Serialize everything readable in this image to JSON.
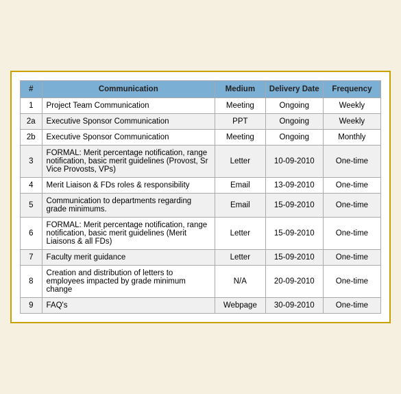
{
  "table": {
    "headers": {
      "num": "#",
      "communication": "Communication",
      "medium": "Medium",
      "delivery_date": "Delivery Date",
      "frequency": "Frequency"
    },
    "rows": [
      {
        "num": "1",
        "communication": "Project Team Communication",
        "medium": "Meeting",
        "delivery_date": "Ongoing",
        "frequency": "Weekly"
      },
      {
        "num": "2a",
        "communication": "Executive Sponsor Communication",
        "medium": "PPT",
        "delivery_date": "Ongoing",
        "frequency": "Weekly"
      },
      {
        "num": "2b",
        "communication": "Executive Sponsor Communication",
        "medium": "Meeting",
        "delivery_date": "Ongoing",
        "frequency": "Monthly"
      },
      {
        "num": "3",
        "communication": "FORMAL: Merit percentage notification, range notification, basic merit guidelines (Provost, Sr Vice Provosts, VPs)",
        "medium": "Letter",
        "delivery_date": "10-09-2010",
        "frequency": "One-time"
      },
      {
        "num": "4",
        "communication": "Merit Liaison & FDs roles & responsibility",
        "medium": "Email",
        "delivery_date": "13-09-2010",
        "frequency": "One-time"
      },
      {
        "num": "5",
        "communication": "Communication to departments regarding grade minimums.",
        "medium": "Email",
        "delivery_date": "15-09-2010",
        "frequency": "One-time"
      },
      {
        "num": "6",
        "communication": "FORMAL: Merit percentage notification, range notification, basic merit guidelines (Merit Liaisons & all FDs)",
        "medium": "Letter",
        "delivery_date": "15-09-2010",
        "frequency": "One-time"
      },
      {
        "num": "7",
        "communication": "Faculty merit guidance",
        "medium": "Letter",
        "delivery_date": "15-09-2010",
        "frequency": "One-time"
      },
      {
        "num": "8",
        "communication": "Creation and distribution of letters to employees impacted by grade minimum change",
        "medium": "N/A",
        "delivery_date": "20-09-2010",
        "frequency": "One-time"
      },
      {
        "num": "9",
        "communication": "FAQ's",
        "medium": "Webpage",
        "delivery_date": "30-09-2010",
        "frequency": "One-time"
      }
    ]
  }
}
